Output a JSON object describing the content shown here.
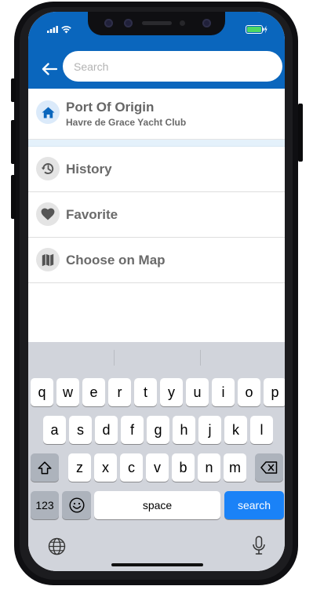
{
  "status_bar": {
    "battery_color": "#4cd964"
  },
  "header": {
    "background": "#0a66bd",
    "search_placeholder": "Search"
  },
  "origin": {
    "title": "Port Of Origin",
    "subtitle": "Havre de Grace Yacht Club"
  },
  "menu": {
    "history": "History",
    "favorite": "Favorite",
    "choose_on_map": "Choose on Map"
  },
  "keyboard": {
    "row1": [
      "q",
      "w",
      "e",
      "r",
      "t",
      "y",
      "u",
      "i",
      "o",
      "p"
    ],
    "row2": [
      "a",
      "s",
      "d",
      "f",
      "g",
      "h",
      "j",
      "k",
      "l"
    ],
    "row3": [
      "z",
      "x",
      "c",
      "v",
      "b",
      "n",
      "m"
    ],
    "numbers_label": "123",
    "space_label": "space",
    "search_label": "search"
  }
}
